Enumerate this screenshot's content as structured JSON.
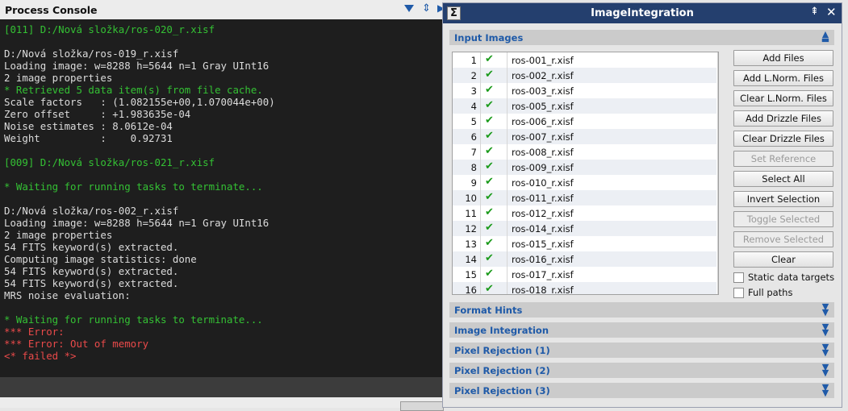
{
  "console": {
    "title": "Process Console",
    "lines": [
      {
        "text": "[011] D:/Nová složka/ros-020_r.xisf",
        "color": "green"
      },
      {
        "text": "",
        "color": "white"
      },
      {
        "text": "D:/Nová složka/ros-019_r.xisf",
        "color": "white"
      },
      {
        "text": "Loading image: w=8288 h=5644 n=1 Gray UInt16",
        "color": "white"
      },
      {
        "text": "2 image properties",
        "color": "white"
      },
      {
        "text": "* Retrieved 5 data item(s) from file cache.",
        "color": "green"
      },
      {
        "text": "Scale factors   : (1.082155e+00,1.070044e+00)",
        "color": "white"
      },
      {
        "text": "Zero offset     : +1.983635e-04",
        "color": "white"
      },
      {
        "text": "Noise estimates : 8.0612e-04",
        "color": "white"
      },
      {
        "text": "Weight          :    0.92731",
        "color": "white"
      },
      {
        "text": "",
        "color": "white"
      },
      {
        "text": "[009] D:/Nová složka/ros-021_r.xisf",
        "color": "green"
      },
      {
        "text": "",
        "color": "white"
      },
      {
        "text": "* Waiting for running tasks to terminate...",
        "color": "green"
      },
      {
        "text": "",
        "color": "white"
      },
      {
        "text": "D:/Nová složka/ros-002_r.xisf",
        "color": "white"
      },
      {
        "text": "Loading image: w=8288 h=5644 n=1 Gray UInt16",
        "color": "white"
      },
      {
        "text": "2 image properties",
        "color": "white"
      },
      {
        "text": "54 FITS keyword(s) extracted.",
        "color": "white"
      },
      {
        "text": "Computing image statistics: done",
        "color": "white"
      },
      {
        "text": "54 FITS keyword(s) extracted.",
        "color": "white"
      },
      {
        "text": "54 FITS keyword(s) extracted.",
        "color": "white"
      },
      {
        "text": "MRS noise evaluation:",
        "color": "white"
      },
      {
        "text": "",
        "color": "white"
      },
      {
        "text": "* Waiting for running tasks to terminate...",
        "color": "green"
      },
      {
        "text": "*** Error:",
        "color": "red"
      },
      {
        "text": "*** Error: Out of memory",
        "color": "red"
      },
      {
        "text": "<* failed *>",
        "color": "red"
      }
    ],
    "icons": {
      "menu": "dropdown-arrow-icon",
      "float": "float-icon"
    }
  },
  "integration": {
    "title": "ImageIntegration",
    "process_icon_glyph": "Σ",
    "input_images": {
      "title": "Input Images",
      "files": [
        {
          "num": "1",
          "name": "ros-001_r.xisf"
        },
        {
          "num": "2",
          "name": "ros-002_r.xisf"
        },
        {
          "num": "3",
          "name": "ros-003_r.xisf"
        },
        {
          "num": "4",
          "name": "ros-005_r.xisf"
        },
        {
          "num": "5",
          "name": "ros-006_r.xisf"
        },
        {
          "num": "6",
          "name": "ros-007_r.xisf"
        },
        {
          "num": "7",
          "name": "ros-008_r.xisf"
        },
        {
          "num": "8",
          "name": "ros-009_r.xisf"
        },
        {
          "num": "9",
          "name": "ros-010_r.xisf"
        },
        {
          "num": "10",
          "name": "ros-011_r.xisf"
        },
        {
          "num": "11",
          "name": "ros-012_r.xisf"
        },
        {
          "num": "12",
          "name": "ros-014_r.xisf"
        },
        {
          "num": "13",
          "name": "ros-015_r.xisf"
        },
        {
          "num": "14",
          "name": "ros-016_r.xisf"
        },
        {
          "num": "15",
          "name": "ros-017_r.xisf"
        },
        {
          "num": "16",
          "name": "ros-018_r.xisf"
        }
      ],
      "buttons": [
        {
          "label": "Add Files",
          "enabled": true
        },
        {
          "label": "Add L.Norm. Files",
          "enabled": true
        },
        {
          "label": "Clear L.Norm. Files",
          "enabled": true
        },
        {
          "label": "Add Drizzle Files",
          "enabled": true
        },
        {
          "label": "Clear Drizzle Files",
          "enabled": true
        },
        {
          "label": "Set Reference",
          "enabled": false
        },
        {
          "label": "Select All",
          "enabled": true
        },
        {
          "label": "Invert Selection",
          "enabled": true
        },
        {
          "label": "Toggle Selected",
          "enabled": false
        },
        {
          "label": "Remove Selected",
          "enabled": false
        },
        {
          "label": "Clear",
          "enabled": true
        }
      ],
      "checkboxes": [
        {
          "label": "Static data targets",
          "checked": false
        },
        {
          "label": "Full paths",
          "checked": false
        }
      ]
    },
    "sections": [
      "Format Hints",
      "Image Integration",
      "Pixel Rejection (1)",
      "Pixel Rejection (2)",
      "Pixel Rejection (3)"
    ]
  }
}
